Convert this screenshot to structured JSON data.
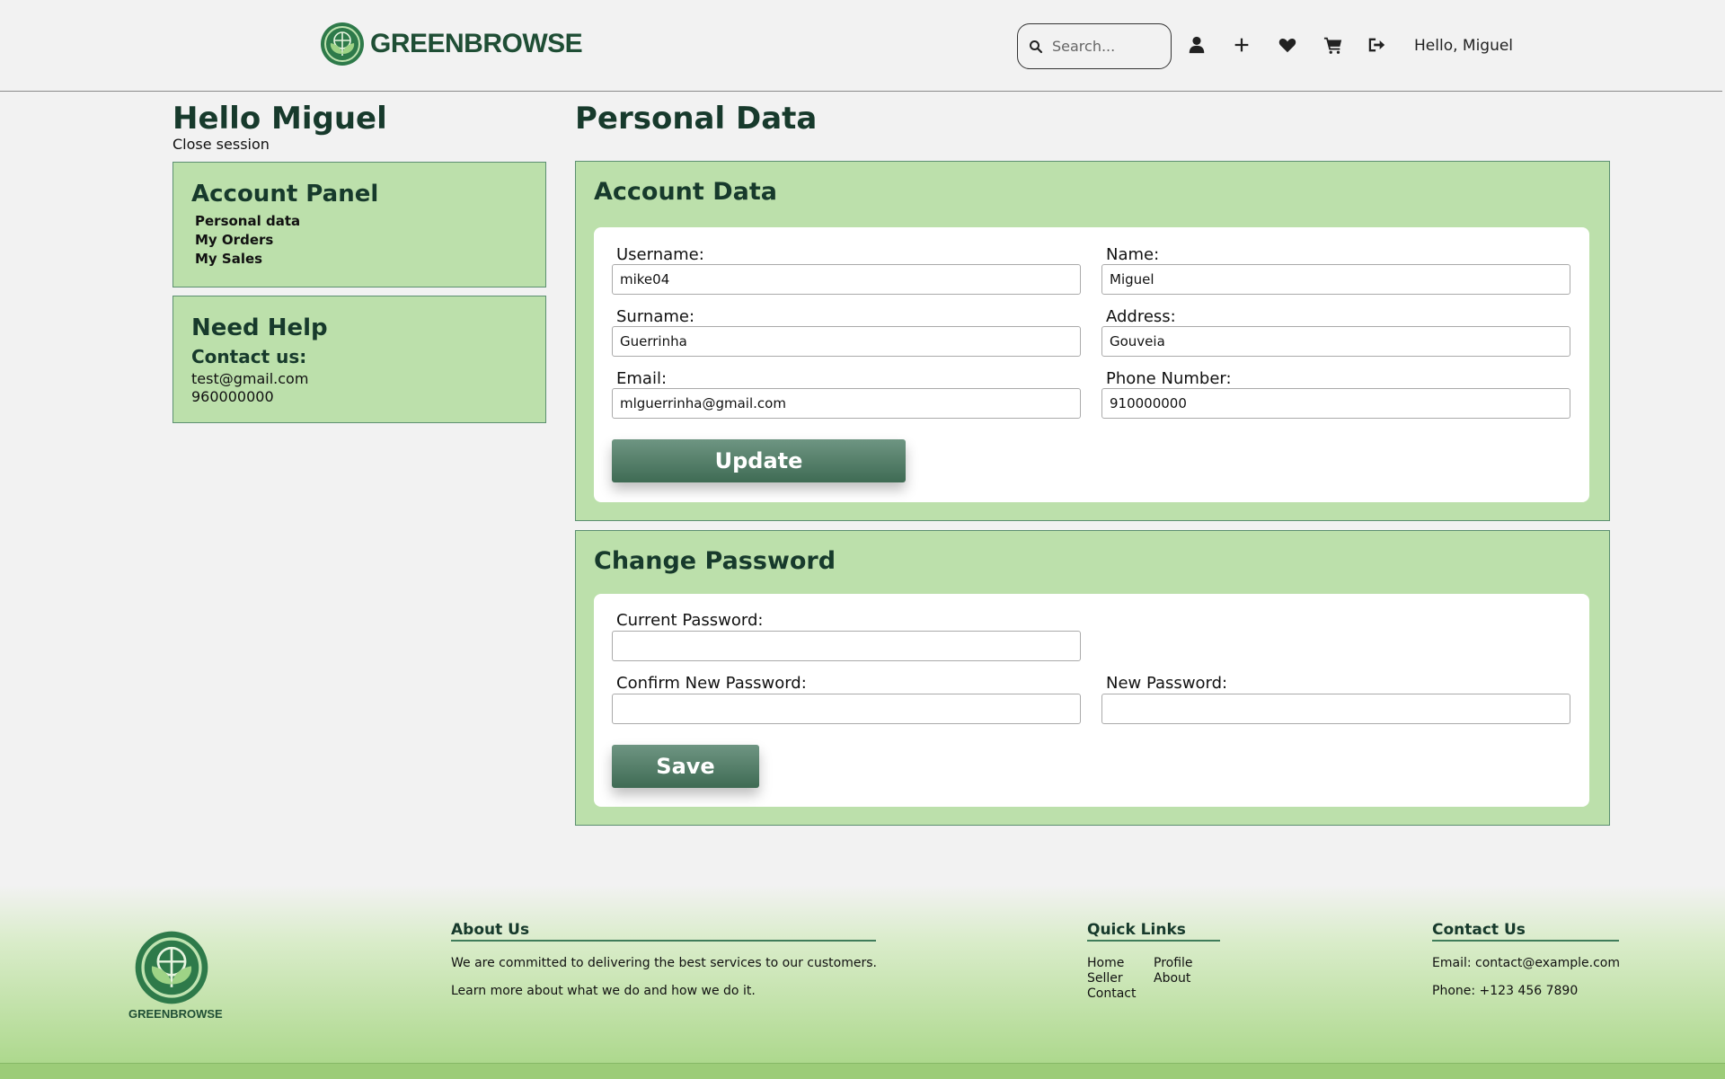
{
  "header": {
    "logo_text": "GREENBROWSE",
    "search_placeholder": "Search...",
    "greeting": "Hello, Miguel",
    "icons": [
      "user-icon",
      "plus-icon",
      "heart-icon",
      "cart-icon",
      "logout-icon"
    ]
  },
  "sidebar": {
    "hello": "Hello Miguel",
    "close_session": "Close session",
    "account_panel": {
      "title": "Account Panel",
      "links": [
        "Personal data",
        "My Orders",
        "My Sales"
      ]
    },
    "help": {
      "title": "Need Help",
      "subtitle": "Contact us:",
      "email": "test@gmail.com",
      "phone": "960000000"
    }
  },
  "main": {
    "title": "Personal Data",
    "account": {
      "title": "Account Data",
      "fields": {
        "username": {
          "label": "Username:",
          "value": "mike04"
        },
        "name": {
          "label": "Name:",
          "value": "Miguel"
        },
        "surname": {
          "label": "Surname:",
          "value": "Guerrinha"
        },
        "address": {
          "label": "Address:",
          "value": "Gouveia"
        },
        "email": {
          "label": "Email:",
          "value": "mlguerrinha@gmail.com"
        },
        "phone": {
          "label": "Phone Number:",
          "value": "910000000"
        }
      },
      "button": "Update"
    },
    "password": {
      "title": "Change Password",
      "current_label": "Current Password:",
      "confirm_label": "Confirm New Password:",
      "new_label": "New Password:",
      "button": "Save"
    }
  },
  "footer": {
    "logo_text": "GREENBROWSE",
    "about": {
      "title": "About Us",
      "line1": "We are committed to delivering the best services to our customers.",
      "line2": "Learn more about what we do and how we do it."
    },
    "quick_links": {
      "title": "Quick Links",
      "home": "Home",
      "seller": "Seller",
      "contact": "Contact",
      "profile": "Profile",
      "about": "About"
    },
    "contact": {
      "title": "Contact Us",
      "email": "Email: contact@example.com",
      "phone": "Phone: +123 456 7890"
    }
  },
  "colors": {
    "accent_green": "#bce0ab",
    "dark_green": "#173a2c",
    "button_green": "#3f6b54"
  }
}
